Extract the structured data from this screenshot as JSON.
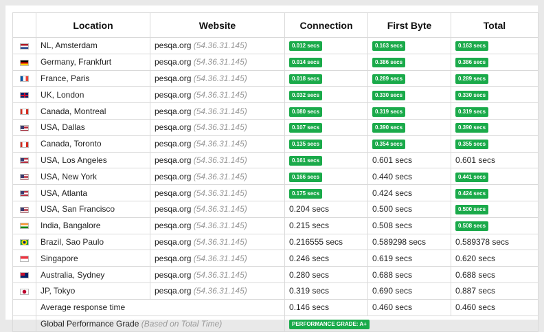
{
  "headers": {
    "location": "Location",
    "website": "Website",
    "connection": "Connection",
    "first_byte": "First Byte",
    "total": "Total"
  },
  "rows": [
    {
      "flag": "nl",
      "location": "NL, Amsterdam",
      "site": "pesqa.org",
      "ip": "(54.36.31.145)",
      "connection": "0.012 secs",
      "connection_badge": true,
      "first_byte": "0.163 secs",
      "first_byte_badge": true,
      "total": "0.163 secs",
      "total_badge": true
    },
    {
      "flag": "de",
      "location": "Germany, Frankfurt",
      "site": "pesqa.org",
      "ip": "(54.36.31.145)",
      "connection": "0.014 secs",
      "connection_badge": true,
      "first_byte": "0.386 secs",
      "first_byte_badge": true,
      "total": "0.386 secs",
      "total_badge": true
    },
    {
      "flag": "fr",
      "location": "France, Paris",
      "site": "pesqa.org",
      "ip": "(54.36.31.145)",
      "connection": "0.018 secs",
      "connection_badge": true,
      "first_byte": "0.289 secs",
      "first_byte_badge": true,
      "total": "0.289 secs",
      "total_badge": true
    },
    {
      "flag": "uk",
      "location": "UK, London",
      "site": "pesqa.org",
      "ip": "(54.36.31.145)",
      "connection": "0.032 secs",
      "connection_badge": true,
      "first_byte": "0.330 secs",
      "first_byte_badge": true,
      "total": "0.330 secs",
      "total_badge": true
    },
    {
      "flag": "ca",
      "location": "Canada, Montreal",
      "site": "pesqa.org",
      "ip": "(54.36.31.145)",
      "connection": "0.080 secs",
      "connection_badge": true,
      "first_byte": "0.319 secs",
      "first_byte_badge": true,
      "total": "0.319 secs",
      "total_badge": true
    },
    {
      "flag": "us",
      "location": "USA, Dallas",
      "site": "pesqa.org",
      "ip": "(54.36.31.145)",
      "connection": "0.107 secs",
      "connection_badge": true,
      "first_byte": "0.390 secs",
      "first_byte_badge": true,
      "total": "0.390 secs",
      "total_badge": true
    },
    {
      "flag": "ca",
      "location": "Canada, Toronto",
      "site": "pesqa.org",
      "ip": "(54.36.31.145)",
      "connection": "0.135 secs",
      "connection_badge": true,
      "first_byte": "0.354 secs",
      "first_byte_badge": true,
      "total": "0.355 secs",
      "total_badge": true
    },
    {
      "flag": "us",
      "location": "USA, Los Angeles",
      "site": "pesqa.org",
      "ip": "(54.36.31.145)",
      "connection": "0.161 secs",
      "connection_badge": true,
      "first_byte": "0.601 secs",
      "first_byte_badge": false,
      "total": "0.601 secs",
      "total_badge": false
    },
    {
      "flag": "us",
      "location": "USA, New York",
      "site": "pesqa.org",
      "ip": "(54.36.31.145)",
      "connection": "0.166 secs",
      "connection_badge": true,
      "first_byte": "0.440 secs",
      "first_byte_badge": false,
      "total": "0.441 secs",
      "total_badge": true
    },
    {
      "flag": "us",
      "location": "USA, Atlanta",
      "site": "pesqa.org",
      "ip": "(54.36.31.145)",
      "connection": "0.175 secs",
      "connection_badge": true,
      "first_byte": "0.424 secs",
      "first_byte_badge": false,
      "total": "0.424 secs",
      "total_badge": true
    },
    {
      "flag": "us",
      "location": "USA, San Francisco",
      "site": "pesqa.org",
      "ip": "(54.36.31.145)",
      "connection": "0.204 secs",
      "connection_badge": false,
      "first_byte": "0.500 secs",
      "first_byte_badge": false,
      "total": "0.500 secs",
      "total_badge": true
    },
    {
      "flag": "in",
      "location": "India, Bangalore",
      "site": "pesqa.org",
      "ip": "(54.36.31.145)",
      "connection": "0.215 secs",
      "connection_badge": false,
      "first_byte": "0.508 secs",
      "first_byte_badge": false,
      "total": "0.508 secs",
      "total_badge": true
    },
    {
      "flag": "br",
      "location": "Brazil, Sao Paulo",
      "site": "pesqa.org",
      "ip": "(54.36.31.145)",
      "connection": "0.216555 secs",
      "connection_badge": false,
      "first_byte": "0.589298 secs",
      "first_byte_badge": false,
      "total": "0.589378 secs",
      "total_badge": false
    },
    {
      "flag": "sg",
      "location": "Singapore",
      "site": "pesqa.org",
      "ip": "(54.36.31.145)",
      "connection": "0.246 secs",
      "connection_badge": false,
      "first_byte": "0.619 secs",
      "first_byte_badge": false,
      "total": "0.620 secs",
      "total_badge": false
    },
    {
      "flag": "au",
      "location": "Australia, Sydney",
      "site": "pesqa.org",
      "ip": "(54.36.31.145)",
      "connection": "0.280 secs",
      "connection_badge": false,
      "first_byte": "0.688 secs",
      "first_byte_badge": false,
      "total": "0.688 secs",
      "total_badge": false
    },
    {
      "flag": "jp",
      "location": "JP, Tokyo",
      "site": "pesqa.org",
      "ip": "(54.36.31.145)",
      "connection": "0.319 secs",
      "connection_badge": false,
      "first_byte": "0.690 secs",
      "first_byte_badge": false,
      "total": "0.887 secs",
      "total_badge": false
    }
  ],
  "average": {
    "label": "Average response time",
    "connection": "0.146 secs",
    "first_byte": "0.460 secs",
    "total": "0.460 secs"
  },
  "grade": {
    "label": "Global Performance Grade",
    "note": "(Based on Total Time)",
    "badge": "PERFORMANCE GRADE:  A+"
  },
  "colors": {
    "badge_green": "#1aaa4a",
    "ip_gray": "#999999",
    "border": "#d9d9d9"
  }
}
